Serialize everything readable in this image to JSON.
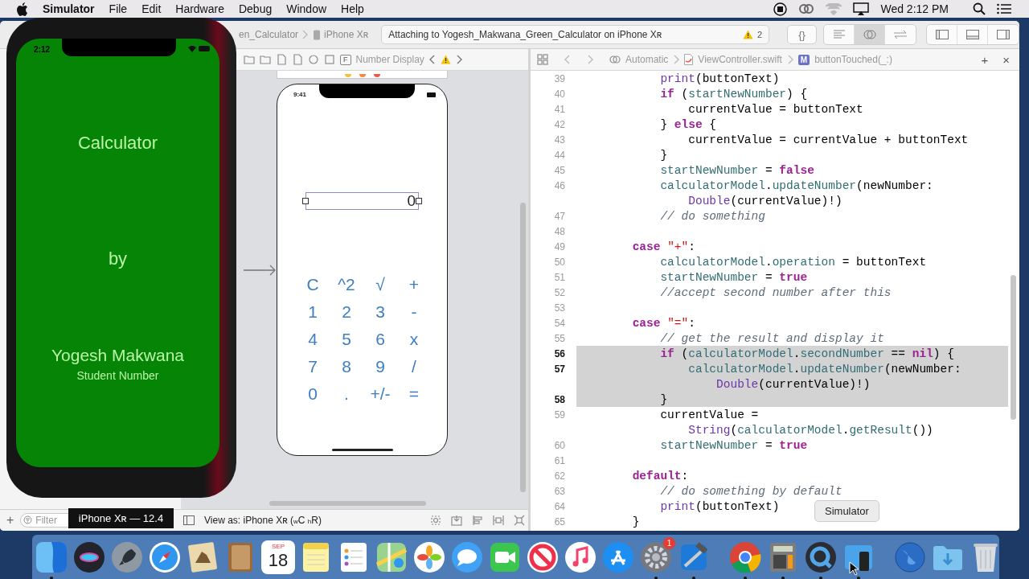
{
  "menu_bar": {
    "app": "Simulator",
    "menus": [
      "File",
      "Edit",
      "Hardware",
      "Debug",
      "Window",
      "Help"
    ],
    "clock": "Wed 2:12 PM"
  },
  "simulator": {
    "status_time": "2:12",
    "title": "Calculator",
    "by": "by",
    "name": "Yogesh Makwana",
    "subtitle": "Student Number"
  },
  "toolbar": {
    "scheme": "en_Calculator",
    "device": "iPhone Xʀ",
    "activity": "Attaching to Yogesh_Makwana_Green_Calculator on iPhone Xʀ",
    "warning_count": "2",
    "braces": "{}",
    "editor_modes": [
      {
        "selected": false
      },
      {
        "selected": true
      },
      {
        "selected": false
      }
    ],
    "panels": [
      {
        "on": false
      },
      {
        "on": false
      },
      {
        "on": false
      }
    ]
  },
  "storyboard_jump_bar": {
    "badge": "F",
    "item": "Number Display"
  },
  "storyboard": {
    "status_time": "9:41",
    "display_value": "0",
    "keys": [
      [
        "C",
        "^2",
        "√",
        "+"
      ],
      [
        "1",
        "2",
        "3",
        "-"
      ],
      [
        "4",
        "5",
        "6",
        "x"
      ],
      [
        "7",
        "8",
        "9",
        "/"
      ],
      [
        "0",
        ".",
        "+/-",
        "="
      ]
    ]
  },
  "editor_jump_bar": {
    "mode": "Automatic",
    "file": "ViewController.swift",
    "method_badge": "M",
    "method": "buttonTouched(_:)",
    "add": "+",
    "close": "×"
  },
  "code_lines": [
    {
      "number": "39",
      "selected": false,
      "tokens": [
        {
          "kind": "sys",
          "text": "            print"
        },
        {
          "kind": "plain",
          "text": "(buttonText)"
        }
      ]
    },
    {
      "number": "40",
      "selected": false,
      "tokens": [
        {
          "kind": "kw",
          "text": "            if"
        },
        {
          "kind": "plain",
          "text": " ("
        },
        {
          "kind": "proj",
          "text": "startNewNumber"
        },
        {
          "kind": "plain",
          "text": ") {"
        }
      ]
    },
    {
      "number": "41",
      "selected": false,
      "tokens": [
        {
          "kind": "plain",
          "text": "                currentValue = buttonText"
        }
      ]
    },
    {
      "number": "42",
      "selected": false,
      "tokens": [
        {
          "kind": "plain",
          "text": "            } "
        },
        {
          "kind": "kw",
          "text": "else"
        },
        {
          "kind": "plain",
          "text": " {"
        }
      ]
    },
    {
      "number": "43",
      "selected": false,
      "tokens": [
        {
          "kind": "plain",
          "text": "                currentValue = currentValue + buttonText"
        }
      ]
    },
    {
      "number": "44",
      "selected": false,
      "tokens": [
        {
          "kind": "plain",
          "text": "            }"
        }
      ]
    },
    {
      "number": "45",
      "selected": false,
      "tokens": [
        {
          "kind": "proj",
          "text": "            startNewNumber"
        },
        {
          "kind": "plain",
          "text": " = "
        },
        {
          "kind": "kw",
          "text": "false"
        }
      ]
    },
    {
      "number": "46",
      "selected": false,
      "tokens": [
        {
          "kind": "proj",
          "text": "            calculatorModel"
        },
        {
          "kind": "plain",
          "text": "."
        },
        {
          "kind": "proj",
          "text": "updateNumber"
        },
        {
          "kind": "plain",
          "text": "(newNumber:"
        }
      ],
      "wrap": [
        {
          "kind": "sys",
          "text": "                Double"
        },
        {
          "kind": "plain",
          "text": "(currentValue)!)"
        }
      ]
    },
    {
      "number": "47",
      "selected": false,
      "tokens": [
        {
          "kind": "comment",
          "text": "            // do something"
        }
      ]
    },
    {
      "number": "48",
      "selected": false
    },
    {
      "number": "49",
      "selected": false,
      "tokens": [
        {
          "kind": "kw",
          "text": "        case"
        },
        {
          "kind": "str",
          "text": " \"+\""
        },
        {
          "kind": "plain",
          "text": ":"
        }
      ]
    },
    {
      "number": "50",
      "selected": false,
      "tokens": [
        {
          "kind": "proj",
          "text": "            calculatorModel"
        },
        {
          "kind": "plain",
          "text": "."
        },
        {
          "kind": "proj",
          "text": "operation"
        },
        {
          "kind": "plain",
          "text": " = buttonText"
        }
      ]
    },
    {
      "number": "51",
      "selected": false,
      "tokens": [
        {
          "kind": "proj",
          "text": "            startNewNumber"
        },
        {
          "kind": "plain",
          "text": " = "
        },
        {
          "kind": "kw",
          "text": "true"
        }
      ]
    },
    {
      "number": "52",
      "selected": false,
      "tokens": [
        {
          "kind": "comment",
          "text": "            //accept second number after this"
        }
      ]
    },
    {
      "number": "53",
      "selected": false
    },
    {
      "number": "54",
      "selected": false,
      "tokens": [
        {
          "kind": "kw",
          "text": "        case"
        },
        {
          "kind": "str",
          "text": " \"=\""
        },
        {
          "kind": "plain",
          "text": ":"
        }
      ]
    },
    {
      "number": "55",
      "selected": false,
      "tokens": [
        {
          "kind": "comment",
          "text": "            // get the result and display it"
        }
      ]
    },
    {
      "number": "56",
      "selected": true,
      "tokens": [
        {
          "kind": "kw",
          "text": "            if"
        },
        {
          "kind": "plain",
          "text": " ("
        },
        {
          "kind": "proj",
          "text": "calculatorModel"
        },
        {
          "kind": "plain",
          "text": "."
        },
        {
          "kind": "proj",
          "text": "secondNumber"
        },
        {
          "kind": "plain",
          "text": " == "
        },
        {
          "kind": "kw",
          "text": "nil"
        },
        {
          "kind": "plain",
          "text": ") {"
        }
      ]
    },
    {
      "number": "57",
      "selected": true,
      "tokens": [
        {
          "kind": "proj",
          "text": "                calculatorModel"
        },
        {
          "kind": "plain",
          "text": "."
        },
        {
          "kind": "proj",
          "text": "updateNumber"
        },
        {
          "kind": "plain",
          "text": "(newNumber:"
        }
      ],
      "wrap": [
        {
          "kind": "sys",
          "text": "                    Double"
        },
        {
          "kind": "plain",
          "text": "(currentValue)!)"
        }
      ]
    },
    {
      "number": "58",
      "selected": true,
      "tokens": [
        {
          "kind": "plain",
          "text": "            }"
        }
      ]
    },
    {
      "number": "59",
      "selected": false,
      "tokens": [
        {
          "kind": "plain",
          "text": "            currentValue ="
        }
      ],
      "wrap": [
        {
          "kind": "sys",
          "text": "                String"
        },
        {
          "kind": "plain",
          "text": "("
        },
        {
          "kind": "proj",
          "text": "calculatorModel"
        },
        {
          "kind": "plain",
          "text": "."
        },
        {
          "kind": "proj",
          "text": "getResult"
        },
        {
          "kind": "plain",
          "text": "())"
        }
      ]
    },
    {
      "number": "60",
      "selected": false,
      "tokens": [
        {
          "kind": "proj",
          "text": "            startNewNumber"
        },
        {
          "kind": "plain",
          "text": " = "
        },
        {
          "kind": "kw",
          "text": "true"
        }
      ]
    },
    {
      "number": "61",
      "selected": false
    },
    {
      "number": "62",
      "selected": false,
      "tokens": [
        {
          "kind": "kw",
          "text": "        default"
        },
        {
          "kind": "plain",
          "text": ":"
        }
      ]
    },
    {
      "number": "63",
      "selected": false,
      "tokens": [
        {
          "kind": "comment",
          "text": "            // do something by default"
        }
      ]
    },
    {
      "number": "64",
      "selected": false,
      "tokens": [
        {
          "kind": "sys",
          "text": "            print"
        },
        {
          "kind": "plain",
          "text": "(buttonText)"
        }
      ]
    },
    {
      "number": "65",
      "selected": false,
      "tokens": [
        {
          "kind": "plain",
          "text": "        }"
        }
      ]
    }
  ],
  "bottom_bar": {
    "add": "+",
    "filter_placeholder": "Filter",
    "view_as": "View as: iPhone Xʀ ($_{w}$C $_{h}$R)"
  },
  "device_tooltip": "iPhone Xʀ — 12.4",
  "dock": {
    "tooltip": "Simulator",
    "items": [
      {
        "kind": "finder",
        "running": true
      },
      {
        "kind": "siri",
        "running": false
      },
      {
        "kind": "launchpad",
        "running": false
      },
      {
        "kind": "safari",
        "running": false
      },
      {
        "kind": "mail",
        "running": false
      },
      {
        "kind": "contacts",
        "running": false
      },
      {
        "kind": "calendar",
        "running": false,
        "month": "SEP",
        "day": "18"
      },
      {
        "kind": "notes",
        "running": false
      },
      {
        "kind": "reminders",
        "running": false
      },
      {
        "kind": "maps",
        "running": false
      },
      {
        "kind": "photos",
        "running": false
      },
      {
        "kind": "messages",
        "running": false
      },
      {
        "kind": "facetime",
        "running": false
      },
      {
        "kind": "news",
        "running": false
      },
      {
        "kind": "music",
        "running": false
      },
      {
        "kind": "appstore",
        "running": false
      },
      {
        "kind": "settings",
        "running": true,
        "badge": "1"
      },
      {
        "kind": "xcode",
        "running": true
      },
      {
        "kind": "separator"
      },
      {
        "kind": "chrome",
        "running": true
      },
      {
        "kind": "calculator",
        "running": true
      },
      {
        "kind": "quicktime",
        "running": true
      },
      {
        "kind": "simulator",
        "running": true
      },
      {
        "kind": "separator"
      },
      {
        "kind": "globe",
        "running": false
      },
      {
        "kind": "downloads",
        "running": false
      },
      {
        "kind": "trash",
        "running": false
      }
    ]
  }
}
